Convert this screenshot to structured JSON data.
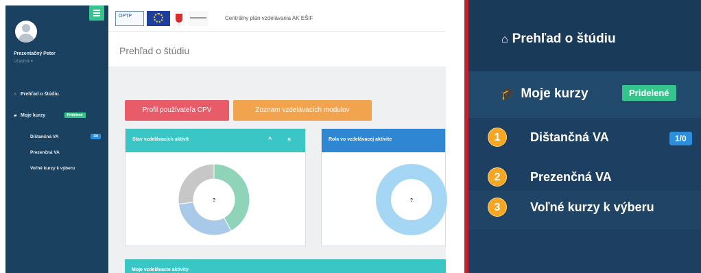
{
  "colors": {
    "sidebar_bg": "#1b4160",
    "accent_green": "#35c58c",
    "accent_blue": "#2d8fdc",
    "btn_profil": "#e85c6a",
    "btn_zoznam": "#f2a34d",
    "panel_teal": "#3ac6c4",
    "panel_blue": "#2f86d2",
    "number_badge": "#f5a623",
    "highlight_border": "#c4212e"
  },
  "sidebar": {
    "user_name": "Prezentačný Peter",
    "user_role": "Účastník",
    "items": [
      {
        "label": "Prehľad o štúdiu",
        "icon": "home-icon"
      },
      {
        "label": "Moje kurzy",
        "icon": "graduation-cap-icon",
        "badge": "Pridelené"
      }
    ],
    "sub_items": [
      {
        "label": "Dištančná VA",
        "count": "1/0"
      },
      {
        "label": "Prezenčná VA"
      },
      {
        "label": "Voľné kurzy k výberu"
      }
    ]
  },
  "topbar": {
    "logos": [
      "OPTP",
      "eu-flag",
      "sk-coat-of-arms",
      "ministry-logo"
    ],
    "optp_text": "OPTP",
    "title": "Centrálny plán vzdelávania AK EŠIF"
  },
  "main": {
    "page_title": "Prehľad o štúdiu",
    "buttons": [
      "Profil používateľa CPV",
      "Zoznam vzdelávacích modulov"
    ],
    "panels": [
      {
        "title": "Stav vzdelávacích aktivít",
        "center_label": "?",
        "controls": [
          "^",
          "×"
        ],
        "segments": [
          {
            "value": 0.42,
            "color": "#8fd3b8"
          },
          {
            "value": 0.31,
            "color": "#a9c9e8"
          },
          {
            "value": 0.27,
            "color": "#c7c7c7"
          }
        ]
      },
      {
        "title": "Rola vo vzdelávacej aktivite",
        "center_label": "?",
        "segments": [
          {
            "value": 1.0,
            "color": "#a5d7f5"
          }
        ]
      },
      {
        "title": "Moje vzdelávacie aktivity"
      }
    ]
  },
  "zoom": {
    "prehlad_label": "Prehľad o štúdiu",
    "kurzy_label": "Moje kurzy",
    "kurzy_badge": "Pridelené",
    "items": [
      {
        "number": "1",
        "label": "Dištančná VA",
        "count": "1/0"
      },
      {
        "number": "2",
        "label": "Prezenčná VA"
      },
      {
        "number": "3",
        "label": "Voľné kurzy k výberu"
      }
    ]
  }
}
